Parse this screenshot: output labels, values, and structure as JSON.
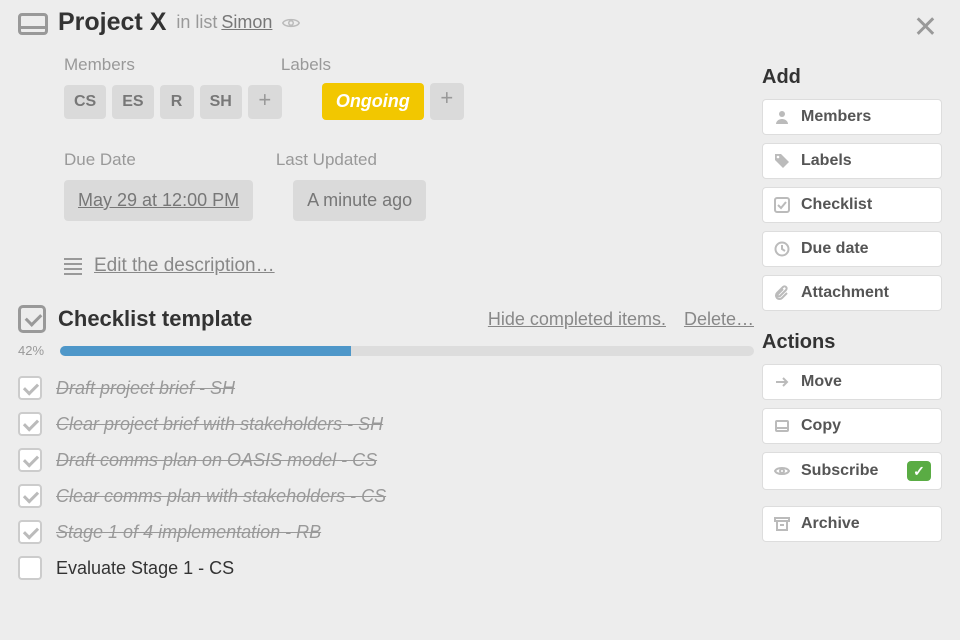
{
  "header": {
    "title": "Project X",
    "in_list_prefix": "in list",
    "list_name": "Simon"
  },
  "members": {
    "heading": "Members",
    "items": [
      "CS",
      "ES",
      "R",
      "SH"
    ]
  },
  "labels": {
    "heading": "Labels",
    "ongoing": "Ongoing"
  },
  "due": {
    "heading": "Due Date",
    "value": "May 29 at 12:00 PM"
  },
  "updated": {
    "heading": "Last Updated",
    "value": "A minute ago"
  },
  "description": {
    "edit": "Edit the description…"
  },
  "checklist": {
    "title": "Checklist template",
    "hide": "Hide completed items.",
    "delete": "Delete…",
    "percent": "42%",
    "percent_num": 42,
    "items": [
      {
        "done": true,
        "text": "Draft project brief - SH"
      },
      {
        "done": true,
        "text": "Clear project brief with stakeholders - SH"
      },
      {
        "done": true,
        "text": "Draft comms plan on OASIS model - CS"
      },
      {
        "done": true,
        "text": "Clear comms plan with stakeholders - CS"
      },
      {
        "done": true,
        "text": "Stage 1 of 4 implementation - RB"
      },
      {
        "done": false,
        "text": "Evaluate Stage 1 - CS"
      }
    ]
  },
  "sidebar": {
    "add_heading": "Add",
    "add": {
      "members": "Members",
      "labels": "Labels",
      "checklist": "Checklist",
      "due": "Due date",
      "attachment": "Attachment"
    },
    "actions_heading": "Actions",
    "actions": {
      "move": "Move",
      "copy": "Copy",
      "subscribe": "Subscribe",
      "archive": "Archive"
    }
  }
}
